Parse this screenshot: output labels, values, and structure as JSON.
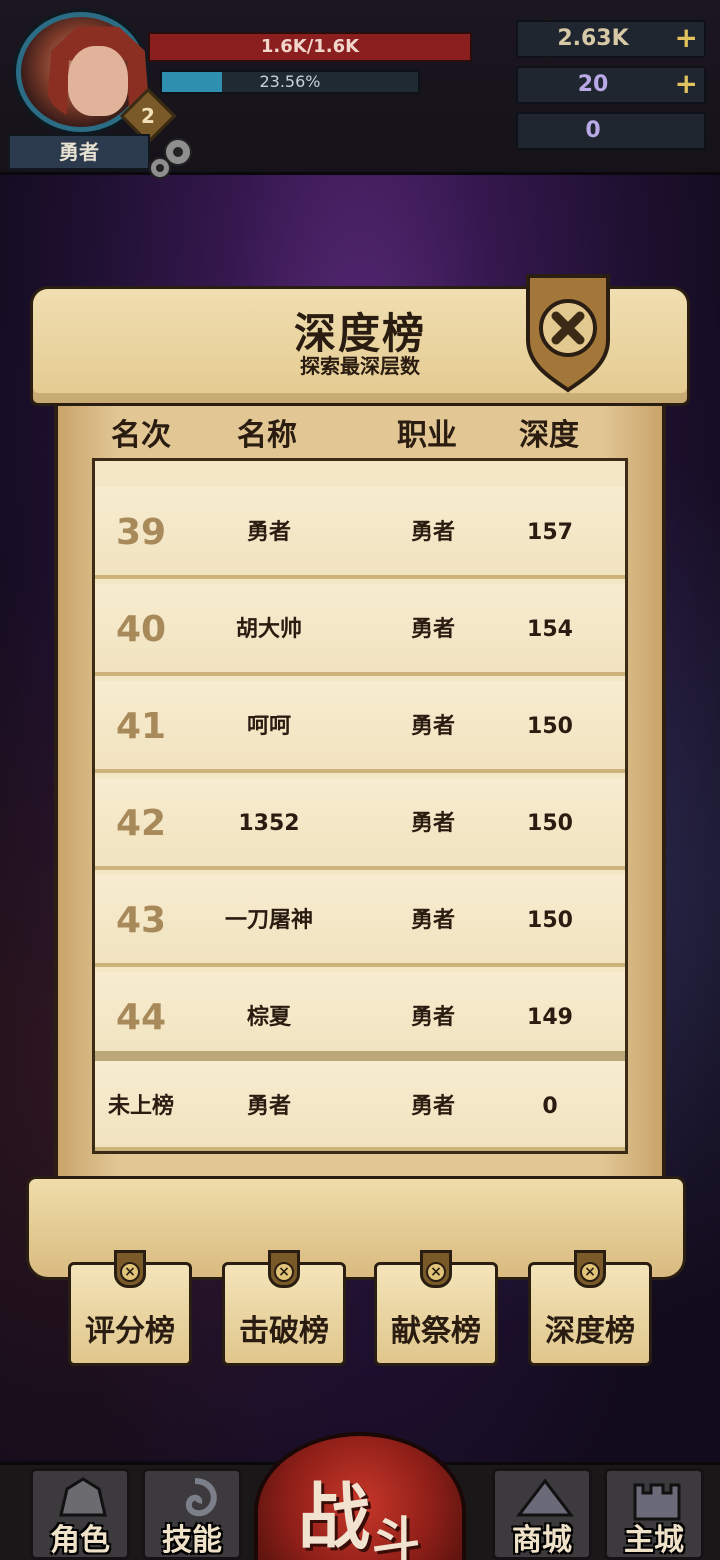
{
  "hud": {
    "hero_label": "勇者",
    "level": "2",
    "hp_text": "1.6K/1.6K",
    "xp_text": "23.56%",
    "xp_fraction": 0.2356,
    "gold": "2.63K",
    "gems": "20",
    "keys": "0",
    "plus": "+"
  },
  "panel": {
    "title": "深度榜",
    "subtitle": "探索最深层数",
    "columns": [
      "名次",
      "名称",
      "职业",
      "深度"
    ]
  },
  "rows": [
    {
      "rank": "39",
      "name": "勇者",
      "job": "勇者",
      "depth": "157"
    },
    {
      "rank": "40",
      "name": "胡大帅",
      "job": "勇者",
      "depth": "154"
    },
    {
      "rank": "41",
      "name": "呵呵",
      "job": "勇者",
      "depth": "150"
    },
    {
      "rank": "42",
      "name": "1352",
      "job": "勇者",
      "depth": "150"
    },
    {
      "rank": "43",
      "name": "一刀屠神",
      "job": "勇者",
      "depth": "150"
    },
    {
      "rank": "44",
      "name": "棕夏",
      "job": "勇者",
      "depth": "149"
    }
  ],
  "my_row": {
    "rank": "未上榜",
    "name": "勇者",
    "job": "勇者",
    "depth": "0"
  },
  "tabs": [
    "评分榜",
    "击破榜",
    "献祭榜",
    "深度榜"
  ],
  "nav": {
    "character": "角色",
    "skills": "技能",
    "battle_a": "战",
    "battle_b": "斗",
    "shop": "商城",
    "city": "主城"
  },
  "icons": {
    "gold": "coin-icon",
    "gems": "crystal-icon",
    "keys": "ram-skull-icon",
    "settings": "gear-icon",
    "close": "close-icon"
  },
  "colors": {
    "hp": "#8b1f1f",
    "xp": "#2f8fae",
    "parchment": "#e2c795",
    "accent_gold": "#e1c25e"
  }
}
